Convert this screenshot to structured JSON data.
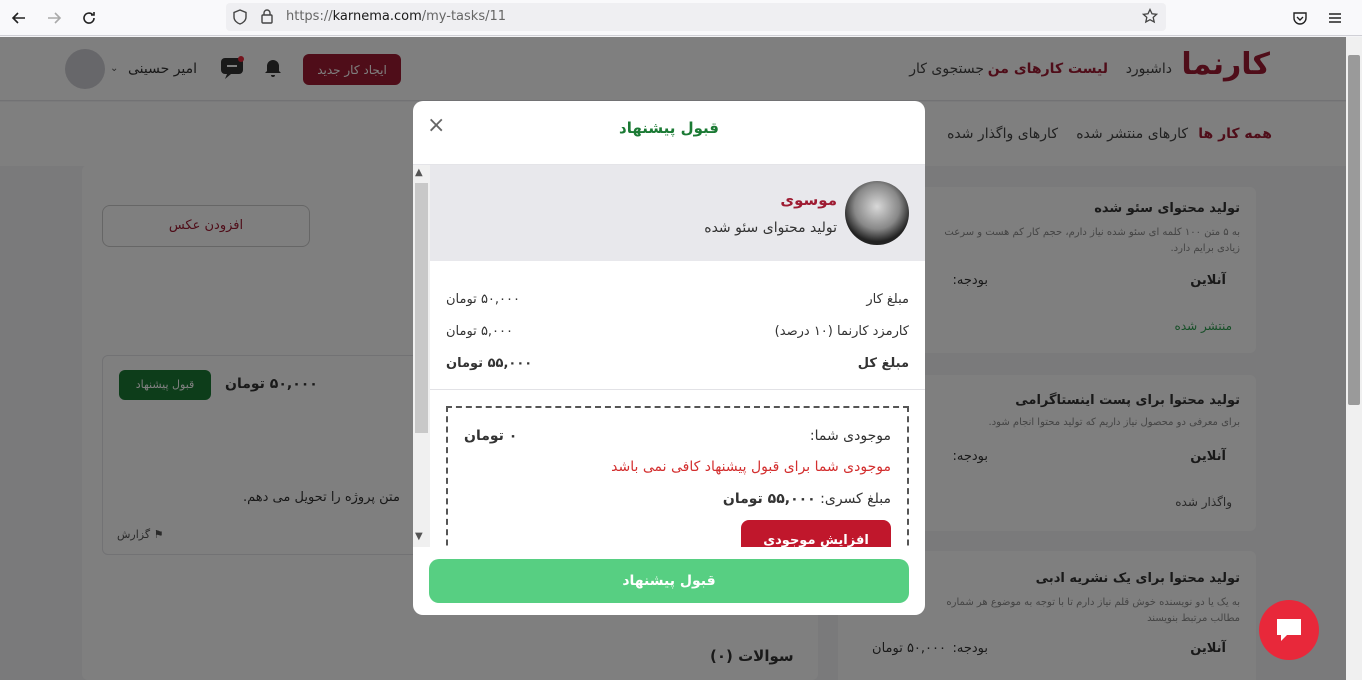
{
  "browser": {
    "url_prefix": "https://",
    "url_host": "karnema.com",
    "url_path": "/my-tasks/11"
  },
  "header": {
    "logo": "کارنما",
    "nav": [
      "داشبورد",
      "لیست کارهای من",
      "جستجوی کار"
    ],
    "create_button": "ایجاد کار جدید",
    "user_name": "امیر حسینی"
  },
  "subnav": {
    "items": [
      "همه کار ها",
      "کارهای منتشر شده",
      "کارهای واگذار شده"
    ]
  },
  "background": {
    "add_photo": "افزودن عکس",
    "offer_price": "۵۰,۰۰۰ تومان",
    "offer_accept": "قبول پیشنهاد",
    "offer_text": "متن پروژه را تحویل می دهم.",
    "report": "گزارش",
    "questions": "سوالات (۰)",
    "tasks": [
      {
        "title": "تولید محتوای سئو شده",
        "desc": "به ۵ متن ۱۰۰ کلمه ای سئو شده نیاز دارم، حجم کار کم هست و سرعت زیادی برایم دارد.",
        "location": "آنلاین",
        "budget_label": "بودجه:",
        "status": "منتشر شده"
      },
      {
        "title": "تولید محتوا برای پست اینستاگرامی",
        "desc": "برای معرفی دو محصول نیاز داریم که تولید محتوا انجام شود.",
        "location": "آنلاین",
        "budget_label": "بودجه:",
        "status": "واگذار شده"
      },
      {
        "title": "تولید محتوا برای یک نشریه ادبی",
        "desc": "به یک یا دو نویسنده خوش قلم نیاز دارم تا با توجه به موضوع هر شماره مطالب مرتبط بنویسند",
        "location": "آنلاین",
        "budget_label": "بودجه:",
        "budget": "۵۰,۰۰۰ تومان"
      }
    ]
  },
  "modal": {
    "title": "قبول پیشنهاد",
    "profile_name": "موسوی",
    "profile_task": "تولید محتوای سئو شده",
    "rows": [
      {
        "label": "مبلغ کار",
        "value": "۵۰,۰۰۰ تومان"
      },
      {
        "label": "کارمزد کارنما (۱۰ درصد)",
        "value": "۵,۰۰۰ تومان"
      },
      {
        "label": "مبلغ کل",
        "value": "۵۵,۰۰۰ تومان"
      }
    ],
    "balance_label": "موجودی شما:",
    "balance_value": "۰ تومان",
    "insufficient": "موجودی شما برای قبول پیشنهاد کافی نمی باشد",
    "deficit_label": "مبلغ کسری:",
    "deficit_value": "۵۵,۰۰۰ تومان",
    "increase_button": "افزایش موجودی",
    "accept_button": "قبول پیشنهاد"
  },
  "colors": {
    "brand": "#9e1b32",
    "green": "#1b7a34",
    "accept": "#57cf82",
    "error": "#d32f2f"
  }
}
